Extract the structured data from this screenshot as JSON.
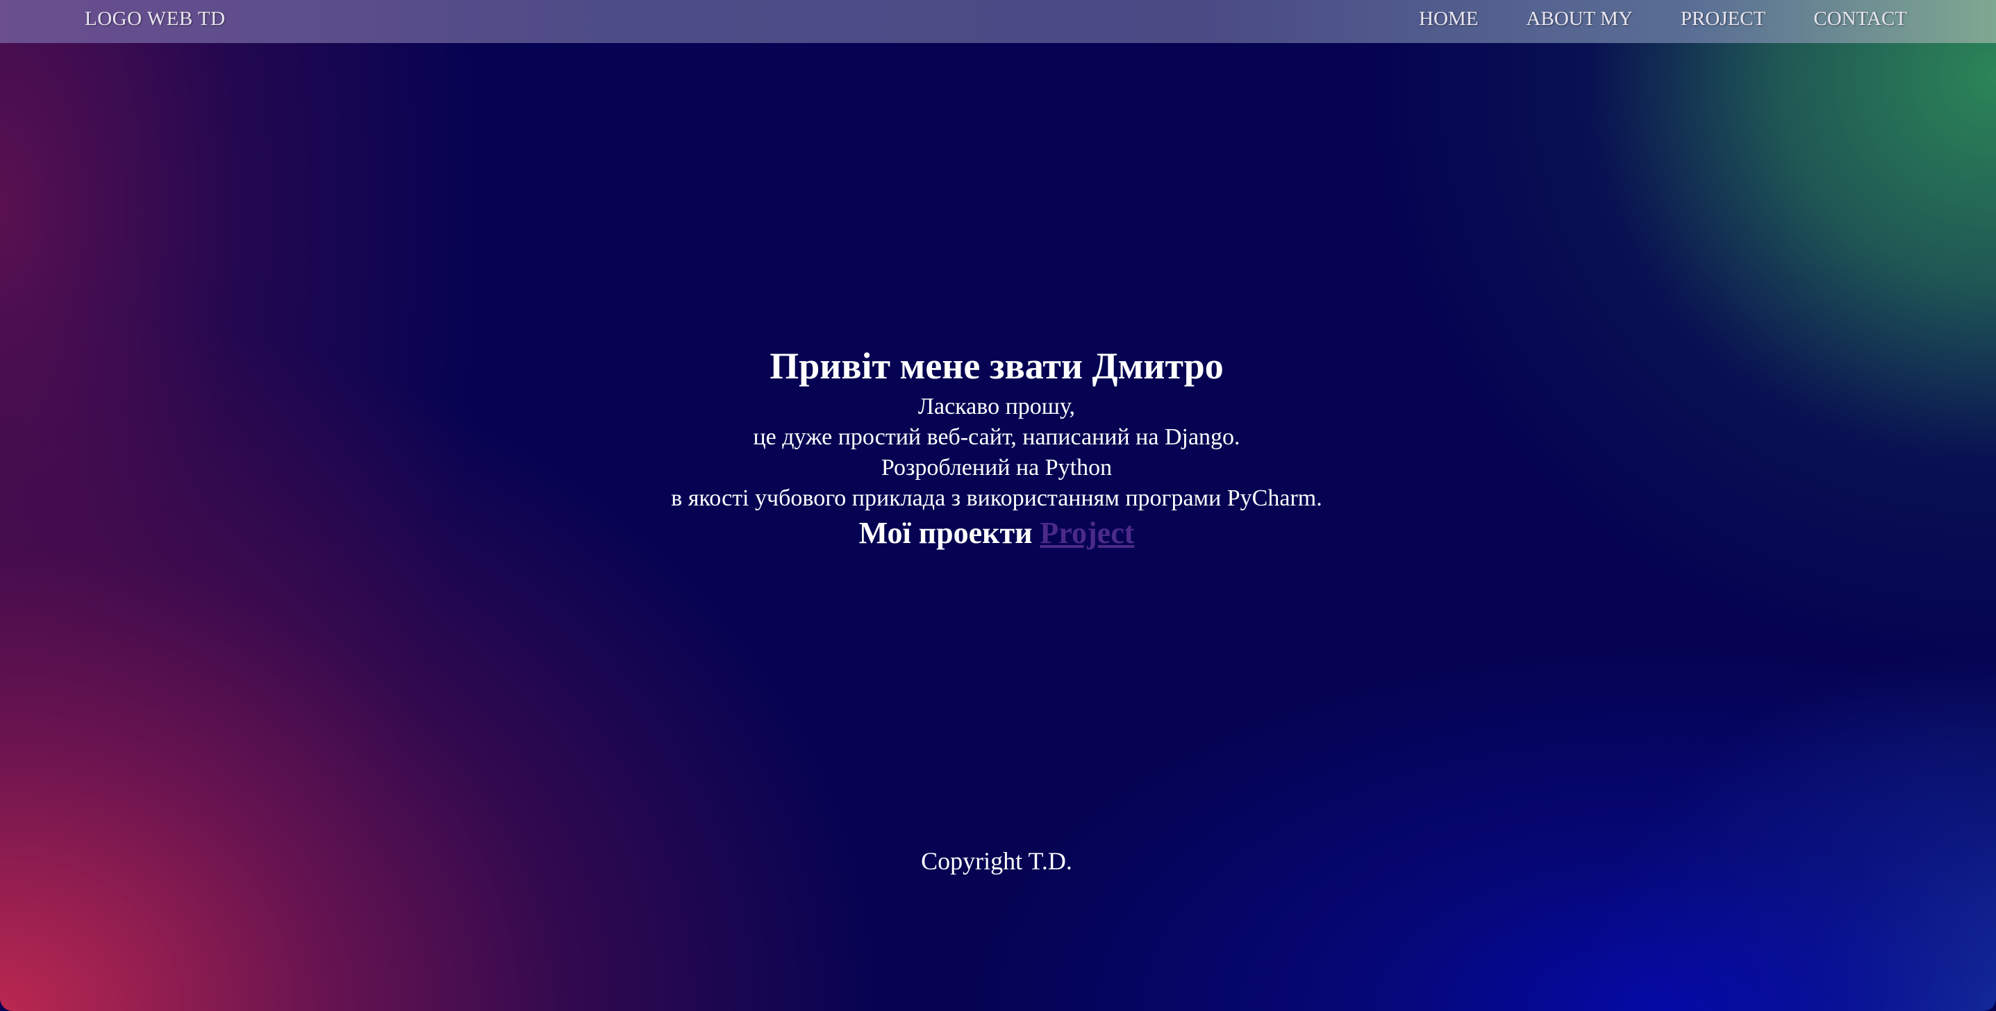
{
  "navbar": {
    "logo": "LOGO WEB TD",
    "links": [
      "HOME",
      "ABOUT MY",
      "PROJECT",
      "CONTACT"
    ]
  },
  "hero": {
    "title": "Привіт мене звати Дмитро",
    "lines": [
      "Ласкаво прошу,",
      "це дуже простий веб-сайт, написаний на Django.",
      "Розроблений на Python",
      "в якості учбового приклада з використанням програми PyCharm."
    ],
    "projects_label": "Мої проекти",
    "projects_link": "Project"
  },
  "footer": {
    "copyright": "Copyright T.D."
  },
  "colors": {
    "background_base": "#050352",
    "accent_red": "#c42a50",
    "accent_green": "#2e8c58",
    "accent_blue": "#050aaa",
    "link_color": "#4b2a88",
    "text": "#ffffff"
  }
}
